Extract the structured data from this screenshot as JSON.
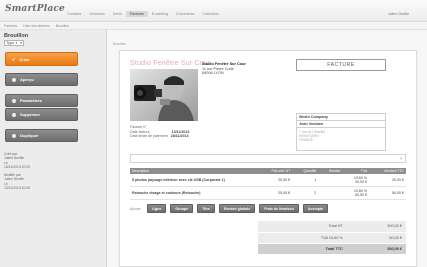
{
  "app": {
    "logo_text": "SmartPlace",
    "user": "Julien Deville"
  },
  "main_nav": [
    "Contacts",
    "Véhicules",
    "Devis",
    "Factures",
    "E-catering",
    "Documents",
    "Calendrier"
  ],
  "sub_nav": [
    "Factures",
    "Liste des factures",
    "Brouillon"
  ],
  "sidebar": {
    "title": "Brouillon",
    "type_value": "Type 1",
    "buttons": {
      "create": "Créer",
      "preview": "Aperçu",
      "params": "Paramètres",
      "delete": "Supprimer",
      "duplicate": "Dupliquer"
    },
    "meta": {
      "created_label": "Créé par",
      "created_by": "Julien Deville",
      "created_on_label": "Le",
      "created_on": "13/11/2013 10:20",
      "modified_label": "Modifié par",
      "modified_by": "Julien Deville",
      "modified_on_label": "Le",
      "modified_on": "13/11/2013 10:20"
    }
  },
  "content": {
    "label": "Brouillon"
  },
  "document": {
    "brand": "Studio Fenêtre Sur Cour",
    "company_name": "Studio Fenêtre Sur Cour",
    "company_addr1": "11 rue Pierre Curie",
    "company_addr2": "69006 LYON",
    "title": "FACTURE",
    "invoice_no_label": "Facture n°",
    "date_label": "Date facture",
    "date_value": "13/11/2013",
    "due_label": "Date limite de paiement",
    "due_value": "28/11/2013",
    "client_company": "World Company",
    "client_name": "Jean Veubien",
    "client_addr1": "7 rue de l'Oisellet",
    "client_addr2": "69000 SAINT",
    "client_country": "FRANCE"
  },
  "lines_table": {
    "headers": [
      "Description",
      "Prix unit. HT",
      "Quantité",
      "Remise",
      "TVA",
      "Montant TTC"
    ],
    "rows": [
      {
        "desc": "5 photos paysage intérieur avec clé USB (Corporate 1)",
        "price": "20,00 €",
        "qty": "1",
        "remise": "",
        "tva": "19,60 %",
        "tva_amount": "20,00 €",
        "total": "20,00 €"
      },
      {
        "desc": "Retouche visage et couleurs (Retouche)",
        "price": "25,00 €",
        "qty": "2",
        "remise": "",
        "tva": "19,60 %",
        "tva_amount": "60,00 €",
        "total": "50,00 €"
      }
    ]
  },
  "toolbar": {
    "label": "Ajouter",
    "buttons": [
      "Ligne",
      "Groupe",
      "Titre",
      "Remise globale",
      "Frais de livraison",
      "Acompte"
    ]
  },
  "totals": [
    {
      "label": "Total HT",
      "value": "300,00 €"
    },
    {
      "label": "TVA 19,60 %",
      "value": "50,00 €"
    },
    {
      "label": "Total TTC",
      "value": "350,00 €"
    }
  ],
  "colors": {
    "accent": "#ea7b14",
    "button_gray": "#7a7a7a",
    "table_header": "#8d8d8d",
    "brand_pink": "#e8a8b8"
  }
}
